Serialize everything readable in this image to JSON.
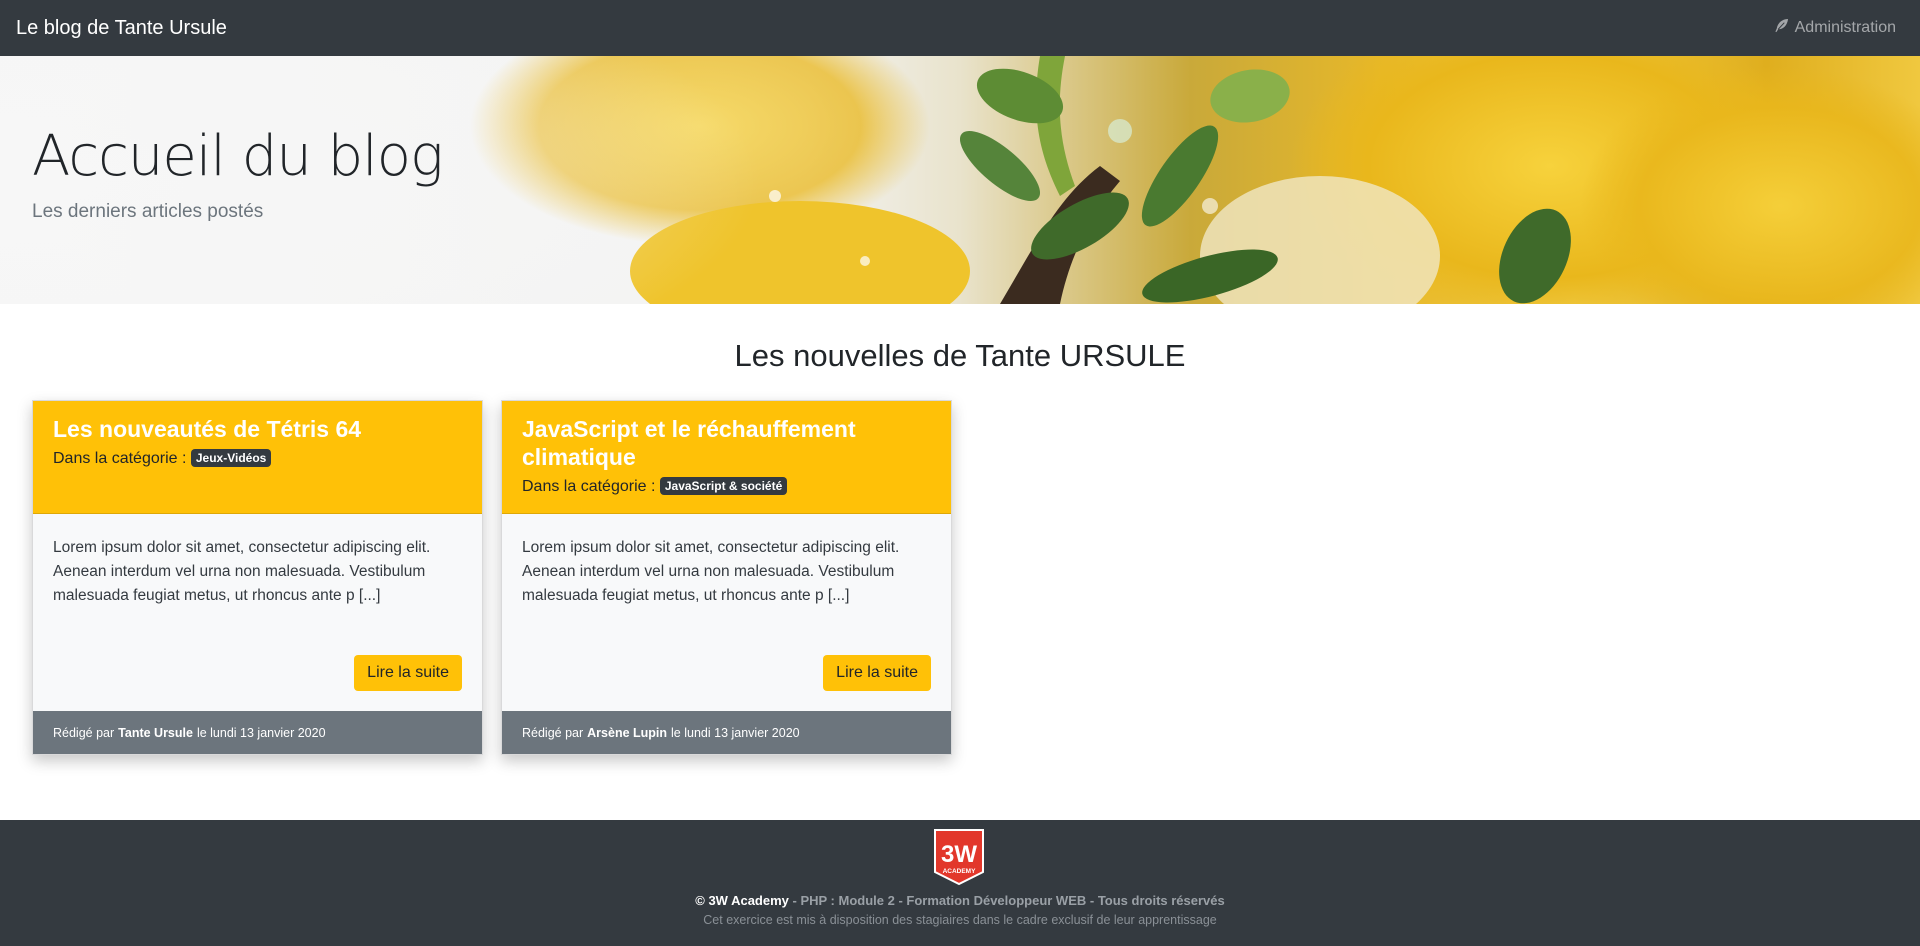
{
  "navbar": {
    "brand": "Le blog de Tante Ursule",
    "admin_label": "Administration",
    "admin_icon": "feather-icon"
  },
  "hero": {
    "title": "Accueil du blog",
    "lead": "Les derniers articles postés"
  },
  "main": {
    "section_title": "Les nouvelles de Tante URSULE",
    "articles": [
      {
        "title": "Les nouveautés de Tétris 64",
        "category_prefix": "Dans la catégorie :",
        "category": "Jeux-Vidéos",
        "excerpt": "Lorem ipsum dolor sit amet, consectetur adipiscing elit. Aenean interdum vel urna non malesuada. Vestibulum malesuada feugiat metus, ut rhoncus ante p [...]",
        "button": "Lire la suite",
        "written_by": "Rédigé par",
        "author": "Tante Ursule",
        "date": "le lundi 13 janvier 2020"
      },
      {
        "title": "JavaScript et le réchauffement climatique",
        "category_prefix": "Dans la catégorie :",
        "category": "JavaScript & société",
        "excerpt": "Lorem ipsum dolor sit amet, consectetur adipiscing elit. Aenean interdum vel urna non malesuada. Vestibulum malesuada feugiat metus, ut rhoncus ante p [...]",
        "button": "Lire la suite",
        "written_by": "Rédigé par",
        "author": "Arsène Lupin",
        "date": "le lundi 13 janvier 2020"
      }
    ]
  },
  "footer": {
    "logo_text": "3W",
    "logo_sub": "ACADEMY",
    "copyright": "© 3W Academy",
    "sep": " - ",
    "course": "PHP : Module 2",
    "formation": "Formation Développeur WEB",
    "rights": "Tous droits réservés",
    "notice": "Cet exercice est mis à disposition des stagiaires dans le cadre exclusif de leur apprentissage"
  },
  "colors": {
    "navbar": "#343a40",
    "accent": "#ffc107",
    "card_footer": "#6c757d",
    "logo_red": "#e2372b"
  }
}
